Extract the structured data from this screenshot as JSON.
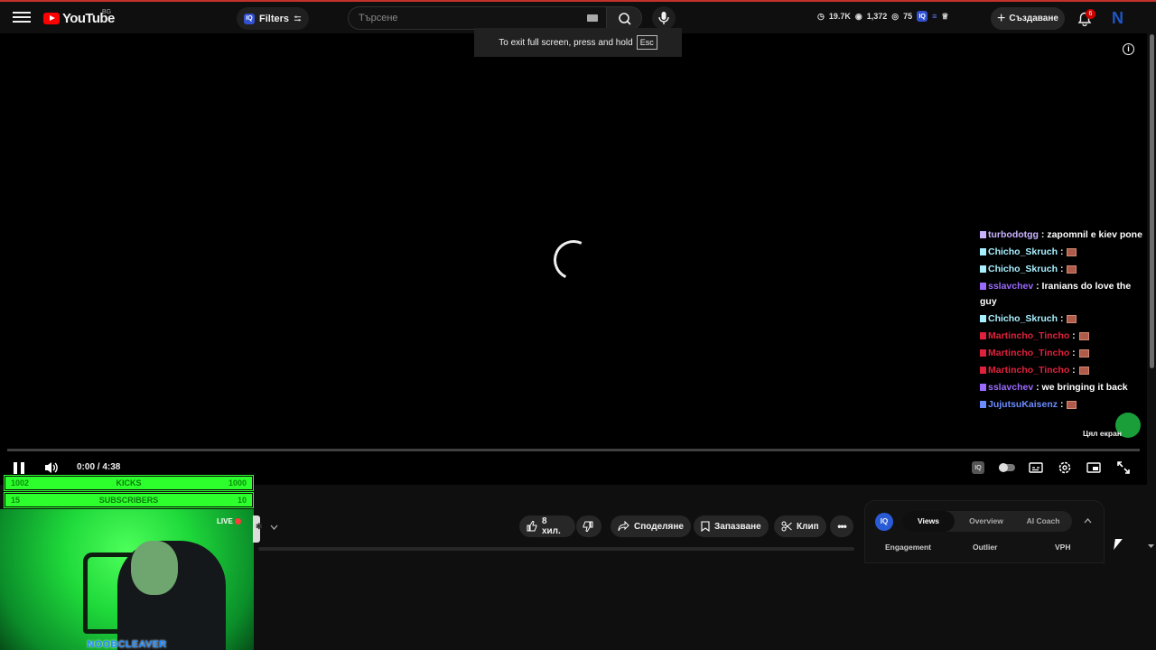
{
  "header": {
    "logo_text": "YouTube",
    "region": "BG",
    "filters_label": "Filters",
    "search_placeholder": "Търсене",
    "stats": {
      "views": "19.7K",
      "watching": "1,372",
      "score": "75"
    },
    "create_label": "Създаване",
    "notification_count": "6",
    "avatar_letter": "N"
  },
  "tooltip": {
    "text": "To exit full screen, press and hold",
    "key": "Esc"
  },
  "player": {
    "time": "0:00 / 4:38",
    "fullscreen_label": "Цял екран"
  },
  "chat": [
    {
      "user": "turbodotgg",
      "color": "#c9b3ff",
      "msg": ": zapomnil e kiev pone"
    },
    {
      "user": "Chicho_Skruch",
      "color": "#a7f0ff",
      "msg": ":"
    },
    {
      "user": "Chicho_Skruch",
      "color": "#a7f0ff",
      "msg": ":"
    },
    {
      "user": "sslavchev",
      "color": "#9b6bff",
      "msg": ": Iranians do love the guy"
    },
    {
      "user": "Chicho_Skruch",
      "color": "#a7f0ff",
      "msg": ":"
    },
    {
      "user": "Martincho_Tincho",
      "color": "#e0213c",
      "msg": ":"
    },
    {
      "user": "Martincho_Tincho",
      "color": "#e0213c",
      "msg": ":"
    },
    {
      "user": "Martincho_Tincho",
      "color": "#e0213c",
      "msg": ":"
    },
    {
      "user": "sslavchev",
      "color": "#9b6bff",
      "msg": ": we bringing it back"
    },
    {
      "user": "JujutsuKaisenz",
      "color": "#6b8bff",
      "msg": ":"
    }
  ],
  "actions": {
    "likes": "8 хил.",
    "share": "Споделяне",
    "save": "Запазване",
    "clip": "Клип"
  },
  "iq_widget": {
    "logo": "IQ",
    "tabs": [
      "Views",
      "Overview",
      "AI Coach"
    ],
    "active_tab": "Views",
    "columns": [
      "Engagement",
      "Outlier",
      "VPH"
    ]
  },
  "overlay": {
    "kicks_left": "1002",
    "kicks_label": "KICKS",
    "kicks_right": "1000",
    "subs_left": "15",
    "subs_label": "SUBSCRIBERS",
    "subs_right": "10",
    "live_label": "LIVE",
    "streamer_name": "NOOBCLEAVER"
  },
  "colors": {
    "accent": "#ff0000",
    "overlay_green": "#2cff2c",
    "iq_blue": "#2a5bd7"
  }
}
